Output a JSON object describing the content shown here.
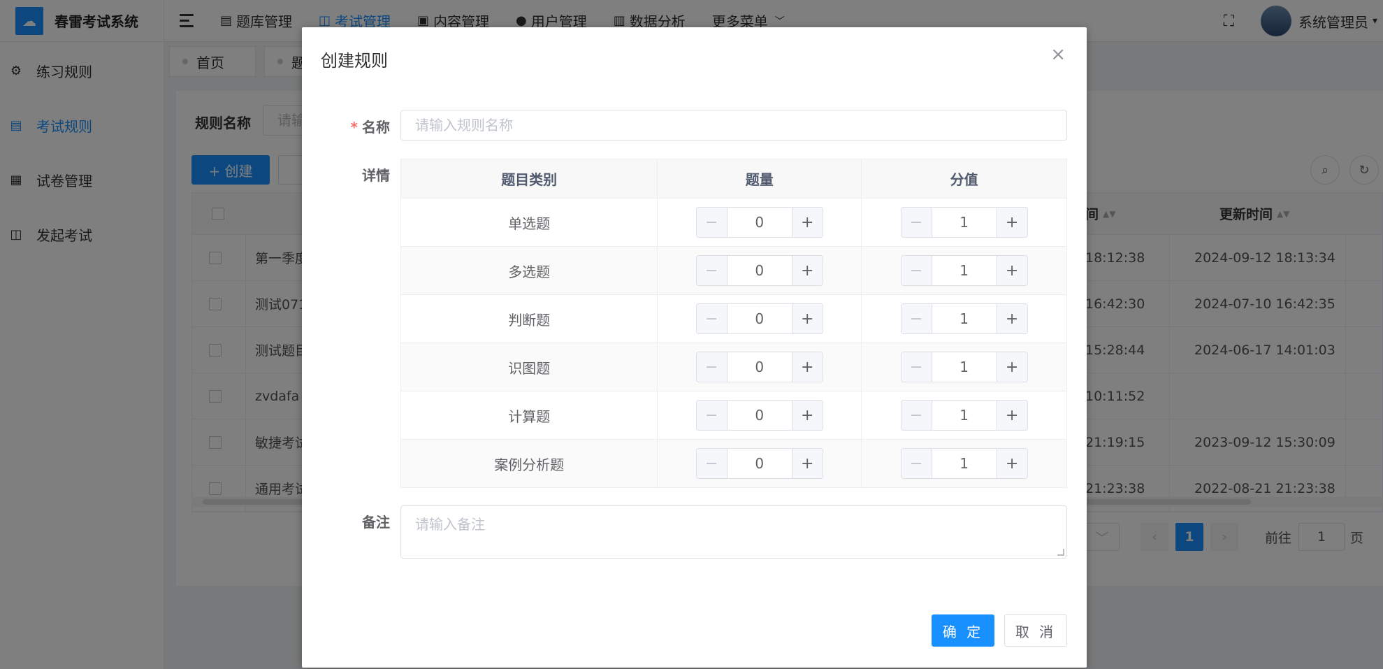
{
  "app": {
    "title": "春雷考试系统"
  },
  "topnav": {
    "items": [
      {
        "label": "题库管理",
        "icon": "file-icon"
      },
      {
        "label": "考试管理",
        "icon": "book-icon",
        "active": true
      },
      {
        "label": "内容管理",
        "icon": "content-icon"
      },
      {
        "label": "用户管理",
        "icon": "user-icon"
      },
      {
        "label": "数据分析",
        "icon": "bar-chart-icon"
      },
      {
        "label": "更多菜单",
        "icon": "chevron-down-icon"
      }
    ],
    "user_name": "系统管理员"
  },
  "sidebar": {
    "items": [
      {
        "label": "练习规则"
      },
      {
        "label": "考试规则",
        "active": true
      },
      {
        "label": "试卷管理"
      },
      {
        "label": "发起考试"
      }
    ]
  },
  "tags": [
    {
      "label": "首页"
    },
    {
      "label": "题"
    }
  ],
  "main": {
    "filter_label": "规则名称",
    "filter_placeholder": "请输",
    "create_label": "+ 创建",
    "columns": {
      "partial_time": "间",
      "update_time": "更新时间"
    },
    "rows": [
      {
        "name": "第一季度",
        "time_a": "18:12:38",
        "time_b": "2024-09-12 18:13:34"
      },
      {
        "name": "测试071",
        "time_a": "16:42:30",
        "time_b": "2024-07-10 16:42:35"
      },
      {
        "name": "测试题目",
        "time_a": "15:28:44",
        "time_b": "2024-06-17 14:01:03"
      },
      {
        "name": "zvdafa",
        "time_a": "10:11:52",
        "time_b": ""
      },
      {
        "name": "敏捷考试",
        "time_a": "21:19:15",
        "time_b": "2023-09-12 15:30:09"
      },
      {
        "name": "通用考试",
        "time_a": "21:23:38",
        "time_b": "2022-08-21 21:23:38"
      }
    ],
    "pager": {
      "current": "1",
      "goto_label": "前往",
      "goto_value": "1",
      "page_unit": "页"
    }
  },
  "dialog": {
    "title": "创建规则",
    "name_label": "名称",
    "name_placeholder": "请输入规则名称",
    "detail_label": "详情",
    "headers": {
      "category": "题目类别",
      "count": "题量",
      "score": "分值"
    },
    "rows": [
      {
        "category": "单选题",
        "count": "0",
        "score": "1"
      },
      {
        "category": "多选题",
        "count": "0",
        "score": "1"
      },
      {
        "category": "判断题",
        "count": "0",
        "score": "1"
      },
      {
        "category": "识图题",
        "count": "0",
        "score": "1"
      },
      {
        "category": "计算题",
        "count": "0",
        "score": "1"
      },
      {
        "category": "案例分析题",
        "count": "0",
        "score": "1"
      }
    ],
    "remark_label": "备注",
    "remark_placeholder": "请输入备注",
    "ok_label": "确 定",
    "cancel_label": "取 消"
  },
  "colors": {
    "primary": "#1890ff",
    "overlay": "rgba(0,0,0,0.5)",
    "required": "#f56c6c"
  }
}
